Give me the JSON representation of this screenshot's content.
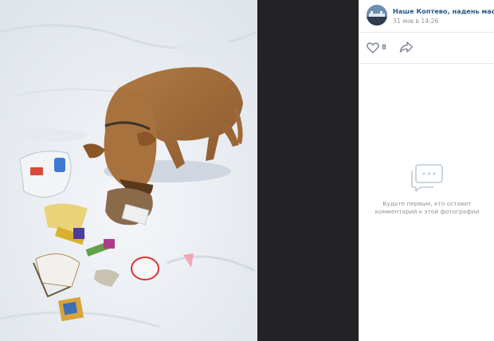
{
  "post": {
    "author_name": "Наше Коптево, надень маску",
    "date": "31 янв в 14:26",
    "likes_count": "8"
  },
  "comments": {
    "empty_line1": "Будьте первым, кто оставит",
    "empty_line2": "комментарий к этой фотографии"
  },
  "icons": {
    "like": "heart-icon",
    "share": "share-arrow-icon",
    "comments": "comment-bubble-icon"
  },
  "colors": {
    "link": "#2a5885",
    "muted": "#939393",
    "panel_bg": "#ffffff",
    "viewer_bg": "#232325"
  }
}
